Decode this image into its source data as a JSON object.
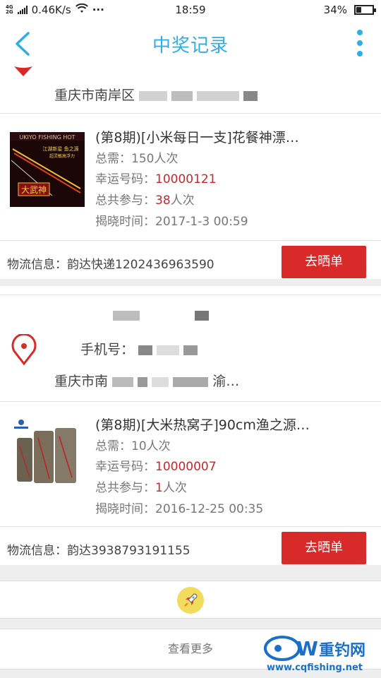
{
  "status_bar": {
    "network_type": "4G",
    "network_type2": "2G",
    "speed": "0.46K/s",
    "dots": "···",
    "time": "18:59",
    "battery": "34%",
    "battery_level": 0.34
  },
  "header": {
    "title": "中奖记录",
    "back_icon": "chevron-left-icon",
    "more_icon": "vertical-dots-icon",
    "accent_color": "#2eaee6"
  },
  "records": [
    {
      "address_partial": "重庆市南岸区",
      "prize": {
        "name": "(第8期)[小米每日一支]花餐神漂…",
        "total_needed_label": "总需：",
        "total_needed_value": "150人次",
        "lucky_label": "幸运号码：",
        "lucky_number": "10000121",
        "participation_label": "总共参与：",
        "participation_count": "38",
        "participation_unit": "人次",
        "reveal_label": "揭晓时间：",
        "reveal_time": "2017-1-3 00:59"
      },
      "logistics_label": "物流信息：",
      "logistics_value": "韵达快递1202436963590",
      "action_label": "去晒单",
      "thumbnail_text": {
        "brand": "UKIYO FISHING HOT",
        "line1": "江湖新星 鱼之源",
        "line2": "超灵敏高浮力",
        "name": "大武神"
      }
    },
    {
      "phone_label": "手机号：",
      "address_partial": "重庆市南",
      "address_tail": "渝…",
      "prize": {
        "name": "(第8期)[大米热窝子]90cm渔之源…",
        "total_needed_label": "总需：",
        "total_needed_value": "10人次",
        "lucky_label": "幸运号码：",
        "lucky_number": "10000007",
        "participation_label": "总共参与：",
        "participation_count": "1",
        "participation_unit": "人次",
        "reveal_label": "揭晓时间：",
        "reveal_time": "2016-12-25 00:35"
      },
      "logistics_label": "物流信息：",
      "logistics_value": "韵达3938793191155",
      "action_label": "去晒单"
    }
  ],
  "footer": {
    "rocket_icon": "rocket-icon",
    "load_more_label": "查看更多"
  },
  "watermark": {
    "text": "重钓网",
    "url": "www.cqfishing.net"
  },
  "colors": {
    "primary": "#2eaee6",
    "action_red": "#d92a2a",
    "highlight_red": "#c8262b"
  }
}
